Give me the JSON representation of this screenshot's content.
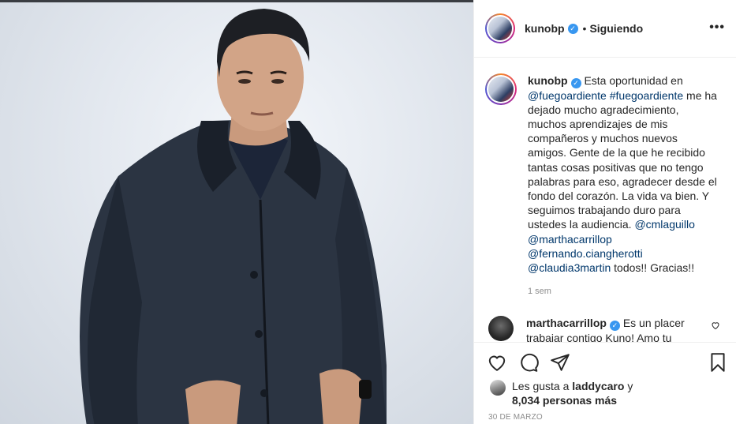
{
  "post": {
    "username": "kunobp",
    "separator": "•",
    "follow_status": "Siguiendo",
    "more_icon": "more-icon",
    "more_label": "•••"
  },
  "caption": {
    "username": "kunobp",
    "text_1": "Esta oportunidad en",
    "mention_1": "@fuegoardiente",
    "hashtag_1": "#fuegoardiente",
    "text_2": "me ha dejado mucho agradecimiento, muchos aprendizajes de mis compañeros y muchos nuevos amigos. Gente de la que he recibido tantas cosas positivas que no tengo palabras para eso, agradecer desde el fondo del corazón. La vida va bien. Y seguimos trabajando duro para ustedes la audiencia.",
    "mention_2": "@cmlaguillo",
    "mention_3": "@marthacarrillop",
    "mention_4": "@fernando.ciangherotti",
    "mention_5": "@claudia3martin",
    "text_3": "todos!! Gracias!!",
    "time": "1 sem"
  },
  "comment": {
    "username": "marthacarrillop",
    "text": "Es un placer trabajar contigo Kuno! Amo tu",
    "like_icon": "heart-icon"
  },
  "actions": {
    "icons": [
      "heart-icon",
      "comment-icon",
      "share-icon",
      "bookmark-icon"
    ],
    "likes_prefix": "Les gusta a",
    "liker": "laddycaro",
    "likes_conj": "y",
    "likes_count": "8,034 personas más",
    "date": "30 DE MARZO"
  }
}
